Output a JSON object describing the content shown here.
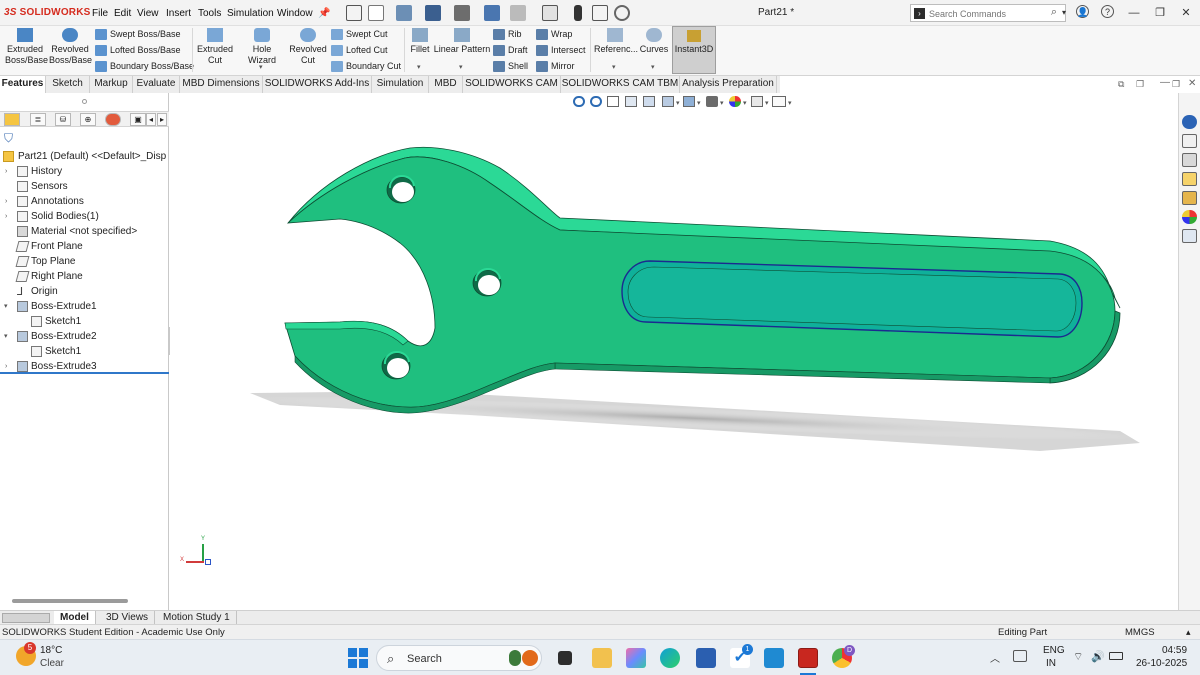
{
  "app": {
    "logo": "SOLIDWORKS",
    "document_title": "Part21 *",
    "menu": [
      "File",
      "Edit",
      "View",
      "Insert",
      "Tools",
      "Simulation",
      "Window"
    ],
    "search_placeholder": "Search Commands"
  },
  "ribbon": {
    "extruded_boss": [
      "Extruded",
      "Boss/Base"
    ],
    "revolved_boss": [
      "Revolved",
      "Boss/Base"
    ],
    "swept_boss": "Swept Boss/Base",
    "lofted_boss": "Lofted Boss/Base",
    "boundary_boss": "Boundary Boss/Base",
    "extruded_cut": [
      "Extruded",
      "Cut"
    ],
    "hole_wizard": "Hole Wizard",
    "revolved_cut": [
      "Revolved",
      "Cut"
    ],
    "swept_cut": "Swept Cut",
    "lofted_cut": "Lofted Cut",
    "boundary_cut": "Boundary Cut",
    "fillet": "Fillet",
    "linear_pattern": "Linear Pattern",
    "rib": "Rib",
    "draft": "Draft",
    "shell": "Shell",
    "wrap": "Wrap",
    "intersect": "Intersect",
    "mirror": "Mirror",
    "reference": "Referenc...",
    "curves": "Curves",
    "instant3d": "Instant3D"
  },
  "tabs": [
    "Features",
    "Sketch",
    "Markup",
    "Evaluate",
    "MBD Dimensions",
    "SOLIDWORKS Add-Ins",
    "Simulation",
    "MBD",
    "SOLIDWORKS CAM",
    "SOLIDWORKS CAM TBM",
    "Analysis Preparation"
  ],
  "active_tab": "Features",
  "tree": {
    "root": "Part21 (Default) <<Default>_Disp",
    "items": [
      {
        "label": "History",
        "icon": "history-icon",
        "expandable": true
      },
      {
        "label": "Sensors",
        "icon": "sensor-icon",
        "expandable": false
      },
      {
        "label": "Annotations",
        "icon": "annotations-icon",
        "expandable": true
      },
      {
        "label": "Solid Bodies(1)",
        "icon": "solid-bodies-icon",
        "expandable": true
      },
      {
        "label": "Material <not specified>",
        "icon": "material-icon",
        "expandable": false
      },
      {
        "label": "Front Plane",
        "icon": "plane-icon",
        "expandable": false
      },
      {
        "label": "Top Plane",
        "icon": "plane-icon",
        "expandable": false
      },
      {
        "label": "Right Plane",
        "icon": "plane-icon",
        "expandable": false
      },
      {
        "label": "Origin",
        "icon": "origin-icon",
        "expandable": false
      },
      {
        "label": "Boss-Extrude1",
        "icon": "extrude-icon",
        "expandable": true,
        "expanded": true
      },
      {
        "label": "Sketch1",
        "icon": "sketch-icon",
        "child": true
      },
      {
        "label": "Boss-Extrude2",
        "icon": "extrude-icon",
        "expandable": true,
        "expanded": true
      },
      {
        "label": "Sketch1",
        "icon": "sketch-icon",
        "child": true
      },
      {
        "label": "Boss-Extrude3",
        "icon": "extrude-icon",
        "expandable": true
      }
    ]
  },
  "triad": {
    "y": "Y",
    "x": "X"
  },
  "bottom_tabs": [
    "Model",
    "3D Views",
    "Motion Study 1"
  ],
  "active_bottom_tab": "Model",
  "status": {
    "edition": "SOLIDWORKS Student Edition - Academic Use Only",
    "mode": "Editing Part",
    "units": "MMGS"
  },
  "taskbar": {
    "weather_badge": "5",
    "temperature": "18°C",
    "condition": "Clear",
    "search_label": "Search",
    "lang_line1": "ENG",
    "lang_line2": "IN",
    "time": "04:59",
    "date": "26-10-2025",
    "notification_badge": "1"
  },
  "colors": {
    "part_face": "#1fbf7f",
    "part_side": "#179a66",
    "part_top": "#2bd996",
    "slot_floor": "#15b69a",
    "accent_red": "#d52b1e"
  }
}
